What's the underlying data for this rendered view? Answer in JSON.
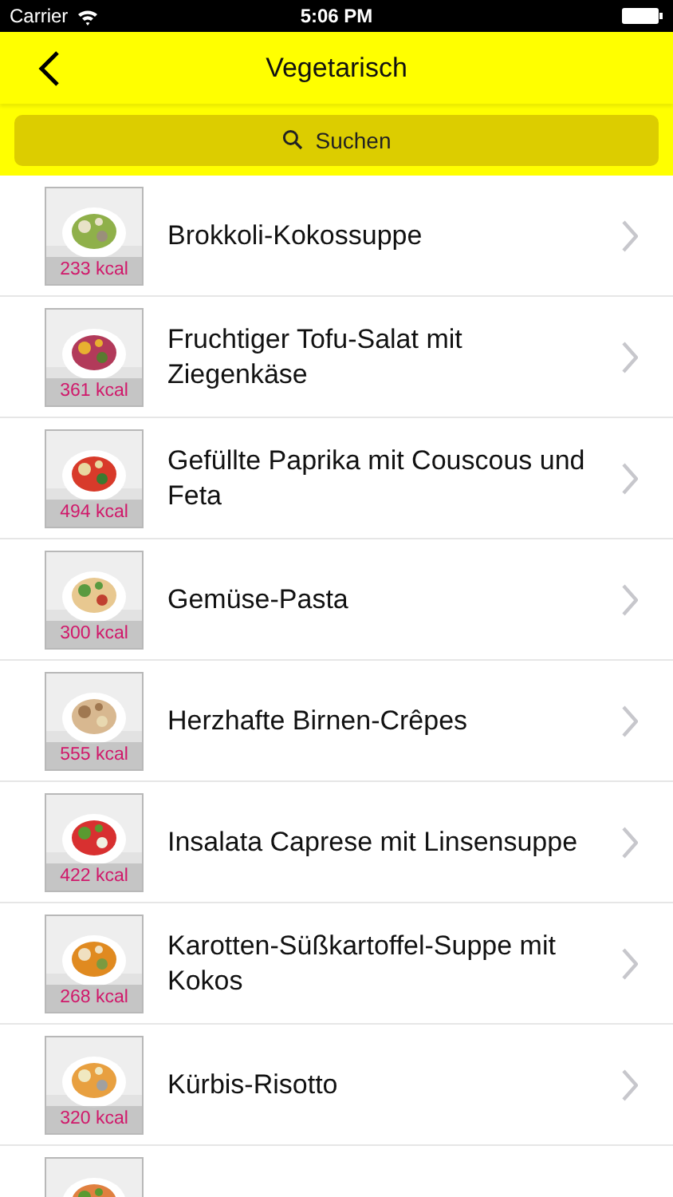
{
  "status_bar": {
    "carrier": "Carrier",
    "time": "5:06 PM"
  },
  "nav": {
    "title": "Vegetarisch"
  },
  "search": {
    "label": "Suchen"
  },
  "recipes": [
    {
      "title": "Brokkoli-Kokossuppe",
      "kcal": "233 kcal",
      "thumbnail": {
        "kind": "picture"
      }
    },
    {
      "title": "Fruchtiger Tofu-Salat mit Ziegenkäse",
      "kcal": "361 kcal",
      "thumbnail": {
        "kind": "picture"
      }
    },
    {
      "title": "Gefüllte Paprika mit Couscous und Feta",
      "kcal": "494 kcal",
      "thumbnail": {
        "kind": "picture"
      }
    },
    {
      "title": "Gemüse-Pasta",
      "kcal": "300 kcal",
      "thumbnail": {
        "kind": "picture"
      }
    },
    {
      "title": "Herzhafte Birnen-Crêpes",
      "kcal": "555 kcal",
      "thumbnail": {
        "kind": "picture"
      }
    },
    {
      "title": "Insalata Caprese mit Linsensuppe",
      "kcal": "422 kcal",
      "thumbnail": {
        "kind": "picture"
      }
    },
    {
      "title": "Karotten-Süßkartoffel-Suppe mit Kokos",
      "kcal": "268 kcal",
      "thumbnail": {
        "kind": "picture"
      }
    },
    {
      "title": "Kürbis-Risotto",
      "kcal": "320 kcal",
      "thumbnail": {
        "kind": "picture"
      }
    },
    {
      "thumbnail": {
        "kind": "picture"
      }
    }
  ]
}
